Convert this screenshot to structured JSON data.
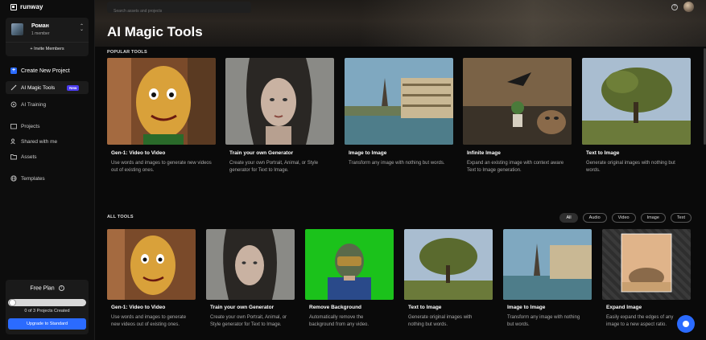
{
  "brand": {
    "name": "runway"
  },
  "workspace": {
    "name": "Роман",
    "members": "1 member",
    "invite_label": "+ Invite Members"
  },
  "sidebar": {
    "items": [
      {
        "label": "Create New Project"
      },
      {
        "label": "AI Magic Tools",
        "badge": "New"
      },
      {
        "label": "AI Training"
      },
      {
        "label": "Projects"
      },
      {
        "label": "Shared with me"
      },
      {
        "label": "Assets"
      },
      {
        "label": "Templates"
      }
    ]
  },
  "plan": {
    "title": "Free Plan",
    "count": "0 of 3 Projects Created",
    "progress": 0,
    "upgrade_label": "Upgrade to Standard"
  },
  "header": {
    "search_placeholder": "Search assets and projects",
    "help_icon": "question-icon"
  },
  "page": {
    "title": "AI Magic Tools"
  },
  "popular": {
    "label": "POPULAR TOOLS",
    "cards": [
      {
        "title": "Gen-1: Video to Video",
        "desc": "Use words and images to generate new videos out of existing ones."
      },
      {
        "title": "Train your own Generator",
        "desc": "Create your own Portrait, Animal, or Style generator for Text to Image."
      },
      {
        "title": "Image to Image",
        "desc": "Transform any image with nothing but words."
      },
      {
        "title": "Infinite Image",
        "desc": "Expand an existing image with context aware Text to Image generation."
      },
      {
        "title": "Text to Image",
        "desc": "Generate original images with nothing but words."
      }
    ]
  },
  "all_tools": {
    "label": "ALL TOOLS",
    "filters": [
      "All",
      "Audio",
      "Video",
      "Image",
      "Text"
    ],
    "active_filter": "All",
    "cards": [
      {
        "title": "Gen-1: Video to Video",
        "desc": "Use words and images to generate new videos out of existing ones."
      },
      {
        "title": "Train your own Generator",
        "desc": "Create your own Portrait, Animal, or Style generator for Text to Image."
      },
      {
        "title": "Remove Background",
        "desc": "Automatically remove the background from any video."
      },
      {
        "title": "Text to Image",
        "desc": "Generate original images with nothing but words."
      },
      {
        "title": "Image to Image",
        "desc": "Transform any image with nothing but words."
      },
      {
        "title": "Expand Image",
        "desc": "Easily expand the edges of any image to a new aspect ratio."
      }
    ]
  },
  "colors": {
    "accent": "#2b6bff",
    "badge": "#4b3cf0",
    "background": "#0a0a0a"
  }
}
